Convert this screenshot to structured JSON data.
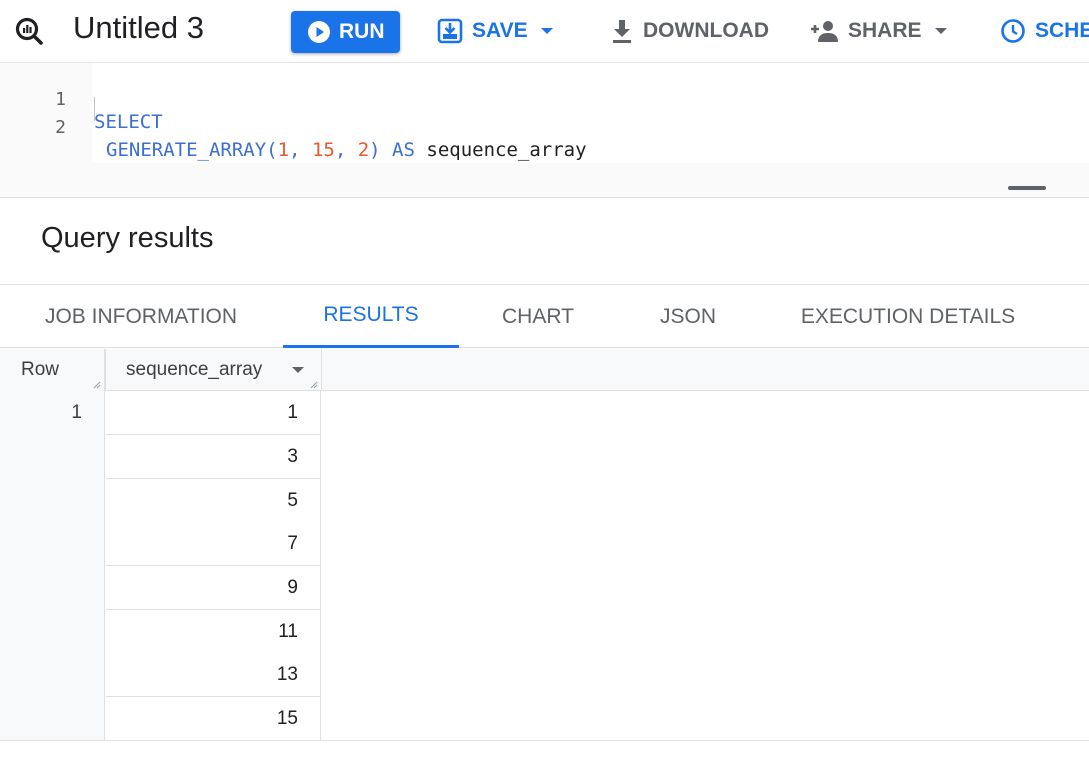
{
  "toolbar": {
    "title": "Untitled 3",
    "run_label": "RUN",
    "save_label": "SAVE",
    "download_label": "DOWNLOAD",
    "share_label": "SHARE",
    "schedule_label": "SCHE",
    "accent_color": "#1a73e8"
  },
  "editor": {
    "lines": [
      {
        "number": "1",
        "tokens": [
          {
            "text": "SELECT",
            "type": "keyword"
          }
        ]
      },
      {
        "number": "2",
        "tokens": [
          {
            "text": "GENERATE_ARRAY(",
            "type": "keyword"
          },
          {
            "text": "1",
            "type": "number"
          },
          {
            "text": ", ",
            "type": "keyword"
          },
          {
            "text": "15",
            "type": "number"
          },
          {
            "text": ", ",
            "type": "keyword"
          },
          {
            "text": "2",
            "type": "number"
          },
          {
            "text": ") AS ",
            "type": "keyword"
          },
          {
            "text": "sequence_array",
            "type": "identifier"
          }
        ]
      }
    ]
  },
  "results": {
    "title": "Query results",
    "tabs": [
      {
        "label": "JOB INFORMATION",
        "active": false
      },
      {
        "label": "RESULTS",
        "active": true
      },
      {
        "label": "CHART",
        "active": false
      },
      {
        "label": "JSON",
        "active": false
      },
      {
        "label": "EXECUTION DETAILS",
        "active": false
      }
    ],
    "columns": [
      "Row",
      "sequence_array"
    ],
    "rows": [
      {
        "row": "1",
        "values": [
          "1",
          "3",
          "5",
          "7",
          "9",
          "11",
          "13",
          "15"
        ]
      }
    ]
  },
  "icons": {
    "product": "bigquery-magnifier-icon",
    "run": "play-circle-icon",
    "save": "save-icon",
    "download": "download-icon",
    "share": "person-add-icon",
    "schedule": "clock-icon",
    "dropdown": "caret-down-icon"
  }
}
